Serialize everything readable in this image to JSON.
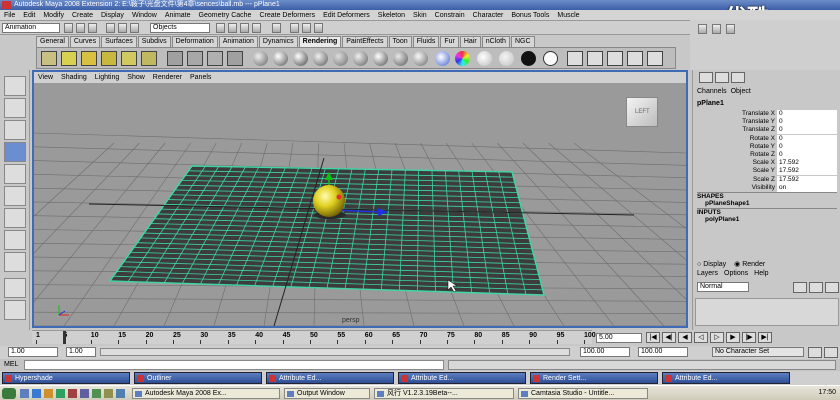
{
  "window": {
    "title": "Autodesk Maya 2008 Extension 2: E:\\鞍子\\光盘文件\\第4章\\sences\\ball.mb   ---   pPlane1"
  },
  "watermark": "优酷",
  "menubar": [
    "File",
    "Edit",
    "Modify",
    "Create",
    "Display",
    "Window",
    "Animate",
    "Geometry Cache",
    "Create Deformers",
    "Edit Deformers",
    "Skeleton",
    "Skin",
    "Constrain",
    "Character",
    "Bonus Tools",
    "Muscle"
  ],
  "statusline": {
    "mode": "Animation",
    "selection_mask": "Objects"
  },
  "shelf_tabs": [
    {
      "label": "General",
      "active": false
    },
    {
      "label": "Curves",
      "active": false
    },
    {
      "label": "Surfaces",
      "active": false
    },
    {
      "label": "Subdivs",
      "active": false
    },
    {
      "label": "Deformation",
      "active": false
    },
    {
      "label": "Animation",
      "active": false
    },
    {
      "label": "Dynamics",
      "active": false
    },
    {
      "label": "Rendering",
      "active": true
    },
    {
      "label": "PaintEffects",
      "active": false
    },
    {
      "label": "Toon",
      "active": false
    },
    {
      "label": "Fluids",
      "active": false
    },
    {
      "label": "Fur",
      "active": false
    },
    {
      "label": "Hair",
      "active": false
    },
    {
      "label": "nCloth",
      "active": false
    },
    {
      "label": "NGC",
      "active": false
    }
  ],
  "viewport": {
    "menu": [
      "View",
      "Shading",
      "Lighting",
      "Show",
      "Renderer",
      "Panels"
    ],
    "camera_label": "persp",
    "viewcube_label": "LEFT"
  },
  "channel_box": {
    "tabs": [
      "Channels",
      "Object"
    ],
    "object_name": "pPlane1",
    "attributes": [
      {
        "label": "Translate X",
        "value": "0"
      },
      {
        "label": "Translate Y",
        "value": "0"
      },
      {
        "label": "Translate Z",
        "value": "0"
      },
      {
        "label": "Rotate X",
        "value": "0"
      },
      {
        "label": "Rotate Y",
        "value": "0"
      },
      {
        "label": "Rotate Z",
        "value": "0"
      },
      {
        "label": "Scale X",
        "value": "17.592"
      },
      {
        "label": "Scale Y",
        "value": "17.592"
      },
      {
        "label": "Scale Z",
        "value": "17.592"
      },
      {
        "label": "Visibility",
        "value": "on"
      }
    ],
    "shapes_header": "SHAPES",
    "shape_name": "pPlaneShape1",
    "inputs_header": "INPUTS",
    "input_name": "polyPlane1"
  },
  "layer_editor": {
    "display_label": "Display",
    "render_label": "Render",
    "menu": [
      "Layers",
      "Options",
      "Help"
    ],
    "blend_mode": "Normal"
  },
  "timeline": {
    "ticks": [
      "1",
      "5",
      "10",
      "15",
      "20",
      "25",
      "30",
      "35",
      "40",
      "45",
      "50",
      "55",
      "60",
      "65",
      "70",
      "75",
      "80",
      "85",
      "90",
      "95",
      "100"
    ],
    "current_frame": "5.00"
  },
  "range": {
    "start_time": "1.00",
    "playback_start": "1.00",
    "playback_end": "100.00",
    "end_time": "100.00",
    "character_set": "No Character Set"
  },
  "mel": {
    "label": "MEL"
  },
  "floating_windows": [
    "Hypershade",
    "Outliner",
    "Attribute Ed...",
    "Attribute Ed...",
    "Render Sett...",
    "Attribute Ed..."
  ],
  "taskbar": {
    "items": [
      "Autodesk Maya 2008 Ex...",
      "Output Window",
      "风行 V1.2.3.19Beta--...",
      "Camtasia Studio - Untitle..."
    ],
    "clock": "17:50"
  },
  "colors": {
    "accent": "#3f6ab5",
    "grid_wire": "#3ed6a6",
    "ball": "#e0d020"
  }
}
